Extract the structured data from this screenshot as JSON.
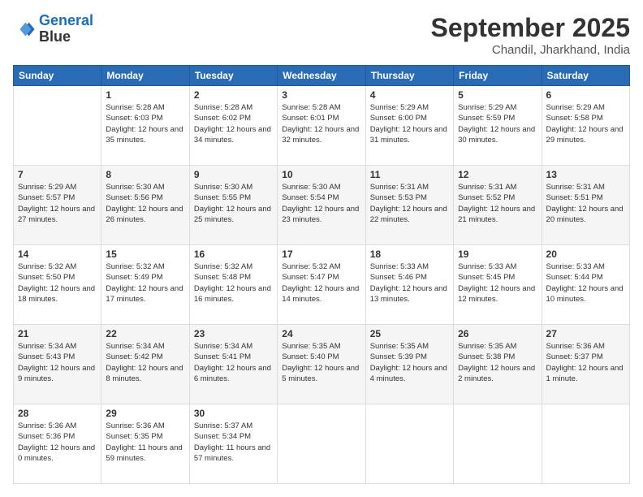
{
  "logo": {
    "line1": "General",
    "line2": "Blue"
  },
  "title": "September 2025",
  "location": "Chandil, Jharkhand, India",
  "weekdays": [
    "Sunday",
    "Monday",
    "Tuesday",
    "Wednesday",
    "Thursday",
    "Friday",
    "Saturday"
  ],
  "weeks": [
    [
      null,
      {
        "day": 1,
        "sunrise": "5:28 AM",
        "sunset": "6:03 PM",
        "daylight": "12 hours and 35 minutes."
      },
      {
        "day": 2,
        "sunrise": "5:28 AM",
        "sunset": "6:02 PM",
        "daylight": "12 hours and 34 minutes."
      },
      {
        "day": 3,
        "sunrise": "5:28 AM",
        "sunset": "6:01 PM",
        "daylight": "12 hours and 32 minutes."
      },
      {
        "day": 4,
        "sunrise": "5:29 AM",
        "sunset": "6:00 PM",
        "daylight": "12 hours and 31 minutes."
      },
      {
        "day": 5,
        "sunrise": "5:29 AM",
        "sunset": "5:59 PM",
        "daylight": "12 hours and 30 minutes."
      },
      {
        "day": 6,
        "sunrise": "5:29 AM",
        "sunset": "5:58 PM",
        "daylight": "12 hours and 29 minutes."
      }
    ],
    [
      {
        "day": 7,
        "sunrise": "5:29 AM",
        "sunset": "5:57 PM",
        "daylight": "12 hours and 27 minutes."
      },
      {
        "day": 8,
        "sunrise": "5:30 AM",
        "sunset": "5:56 PM",
        "daylight": "12 hours and 26 minutes."
      },
      {
        "day": 9,
        "sunrise": "5:30 AM",
        "sunset": "5:55 PM",
        "daylight": "12 hours and 25 minutes."
      },
      {
        "day": 10,
        "sunrise": "5:30 AM",
        "sunset": "5:54 PM",
        "daylight": "12 hours and 23 minutes."
      },
      {
        "day": 11,
        "sunrise": "5:31 AM",
        "sunset": "5:53 PM",
        "daylight": "12 hours and 22 minutes."
      },
      {
        "day": 12,
        "sunrise": "5:31 AM",
        "sunset": "5:52 PM",
        "daylight": "12 hours and 21 minutes."
      },
      {
        "day": 13,
        "sunrise": "5:31 AM",
        "sunset": "5:51 PM",
        "daylight": "12 hours and 20 minutes."
      }
    ],
    [
      {
        "day": 14,
        "sunrise": "5:32 AM",
        "sunset": "5:50 PM",
        "daylight": "12 hours and 18 minutes."
      },
      {
        "day": 15,
        "sunrise": "5:32 AM",
        "sunset": "5:49 PM",
        "daylight": "12 hours and 17 minutes."
      },
      {
        "day": 16,
        "sunrise": "5:32 AM",
        "sunset": "5:48 PM",
        "daylight": "12 hours and 16 minutes."
      },
      {
        "day": 17,
        "sunrise": "5:32 AM",
        "sunset": "5:47 PM",
        "daylight": "12 hours and 14 minutes."
      },
      {
        "day": 18,
        "sunrise": "5:33 AM",
        "sunset": "5:46 PM",
        "daylight": "12 hours and 13 minutes."
      },
      {
        "day": 19,
        "sunrise": "5:33 AM",
        "sunset": "5:45 PM",
        "daylight": "12 hours and 12 minutes."
      },
      {
        "day": 20,
        "sunrise": "5:33 AM",
        "sunset": "5:44 PM",
        "daylight": "12 hours and 10 minutes."
      }
    ],
    [
      {
        "day": 21,
        "sunrise": "5:34 AM",
        "sunset": "5:43 PM",
        "daylight": "12 hours and 9 minutes."
      },
      {
        "day": 22,
        "sunrise": "5:34 AM",
        "sunset": "5:42 PM",
        "daylight": "12 hours and 8 minutes."
      },
      {
        "day": 23,
        "sunrise": "5:34 AM",
        "sunset": "5:41 PM",
        "daylight": "12 hours and 6 minutes."
      },
      {
        "day": 24,
        "sunrise": "5:35 AM",
        "sunset": "5:40 PM",
        "daylight": "12 hours and 5 minutes."
      },
      {
        "day": 25,
        "sunrise": "5:35 AM",
        "sunset": "5:39 PM",
        "daylight": "12 hours and 4 minutes."
      },
      {
        "day": 26,
        "sunrise": "5:35 AM",
        "sunset": "5:38 PM",
        "daylight": "12 hours and 2 minutes."
      },
      {
        "day": 27,
        "sunrise": "5:36 AM",
        "sunset": "5:37 PM",
        "daylight": "12 hours and 1 minute."
      }
    ],
    [
      {
        "day": 28,
        "sunrise": "5:36 AM",
        "sunset": "5:36 PM",
        "daylight": "12 hours and 0 minutes."
      },
      {
        "day": 29,
        "sunrise": "5:36 AM",
        "sunset": "5:35 PM",
        "daylight": "11 hours and 59 minutes."
      },
      {
        "day": 30,
        "sunrise": "5:37 AM",
        "sunset": "5:34 PM",
        "daylight": "11 hours and 57 minutes."
      },
      null,
      null,
      null,
      null
    ]
  ]
}
